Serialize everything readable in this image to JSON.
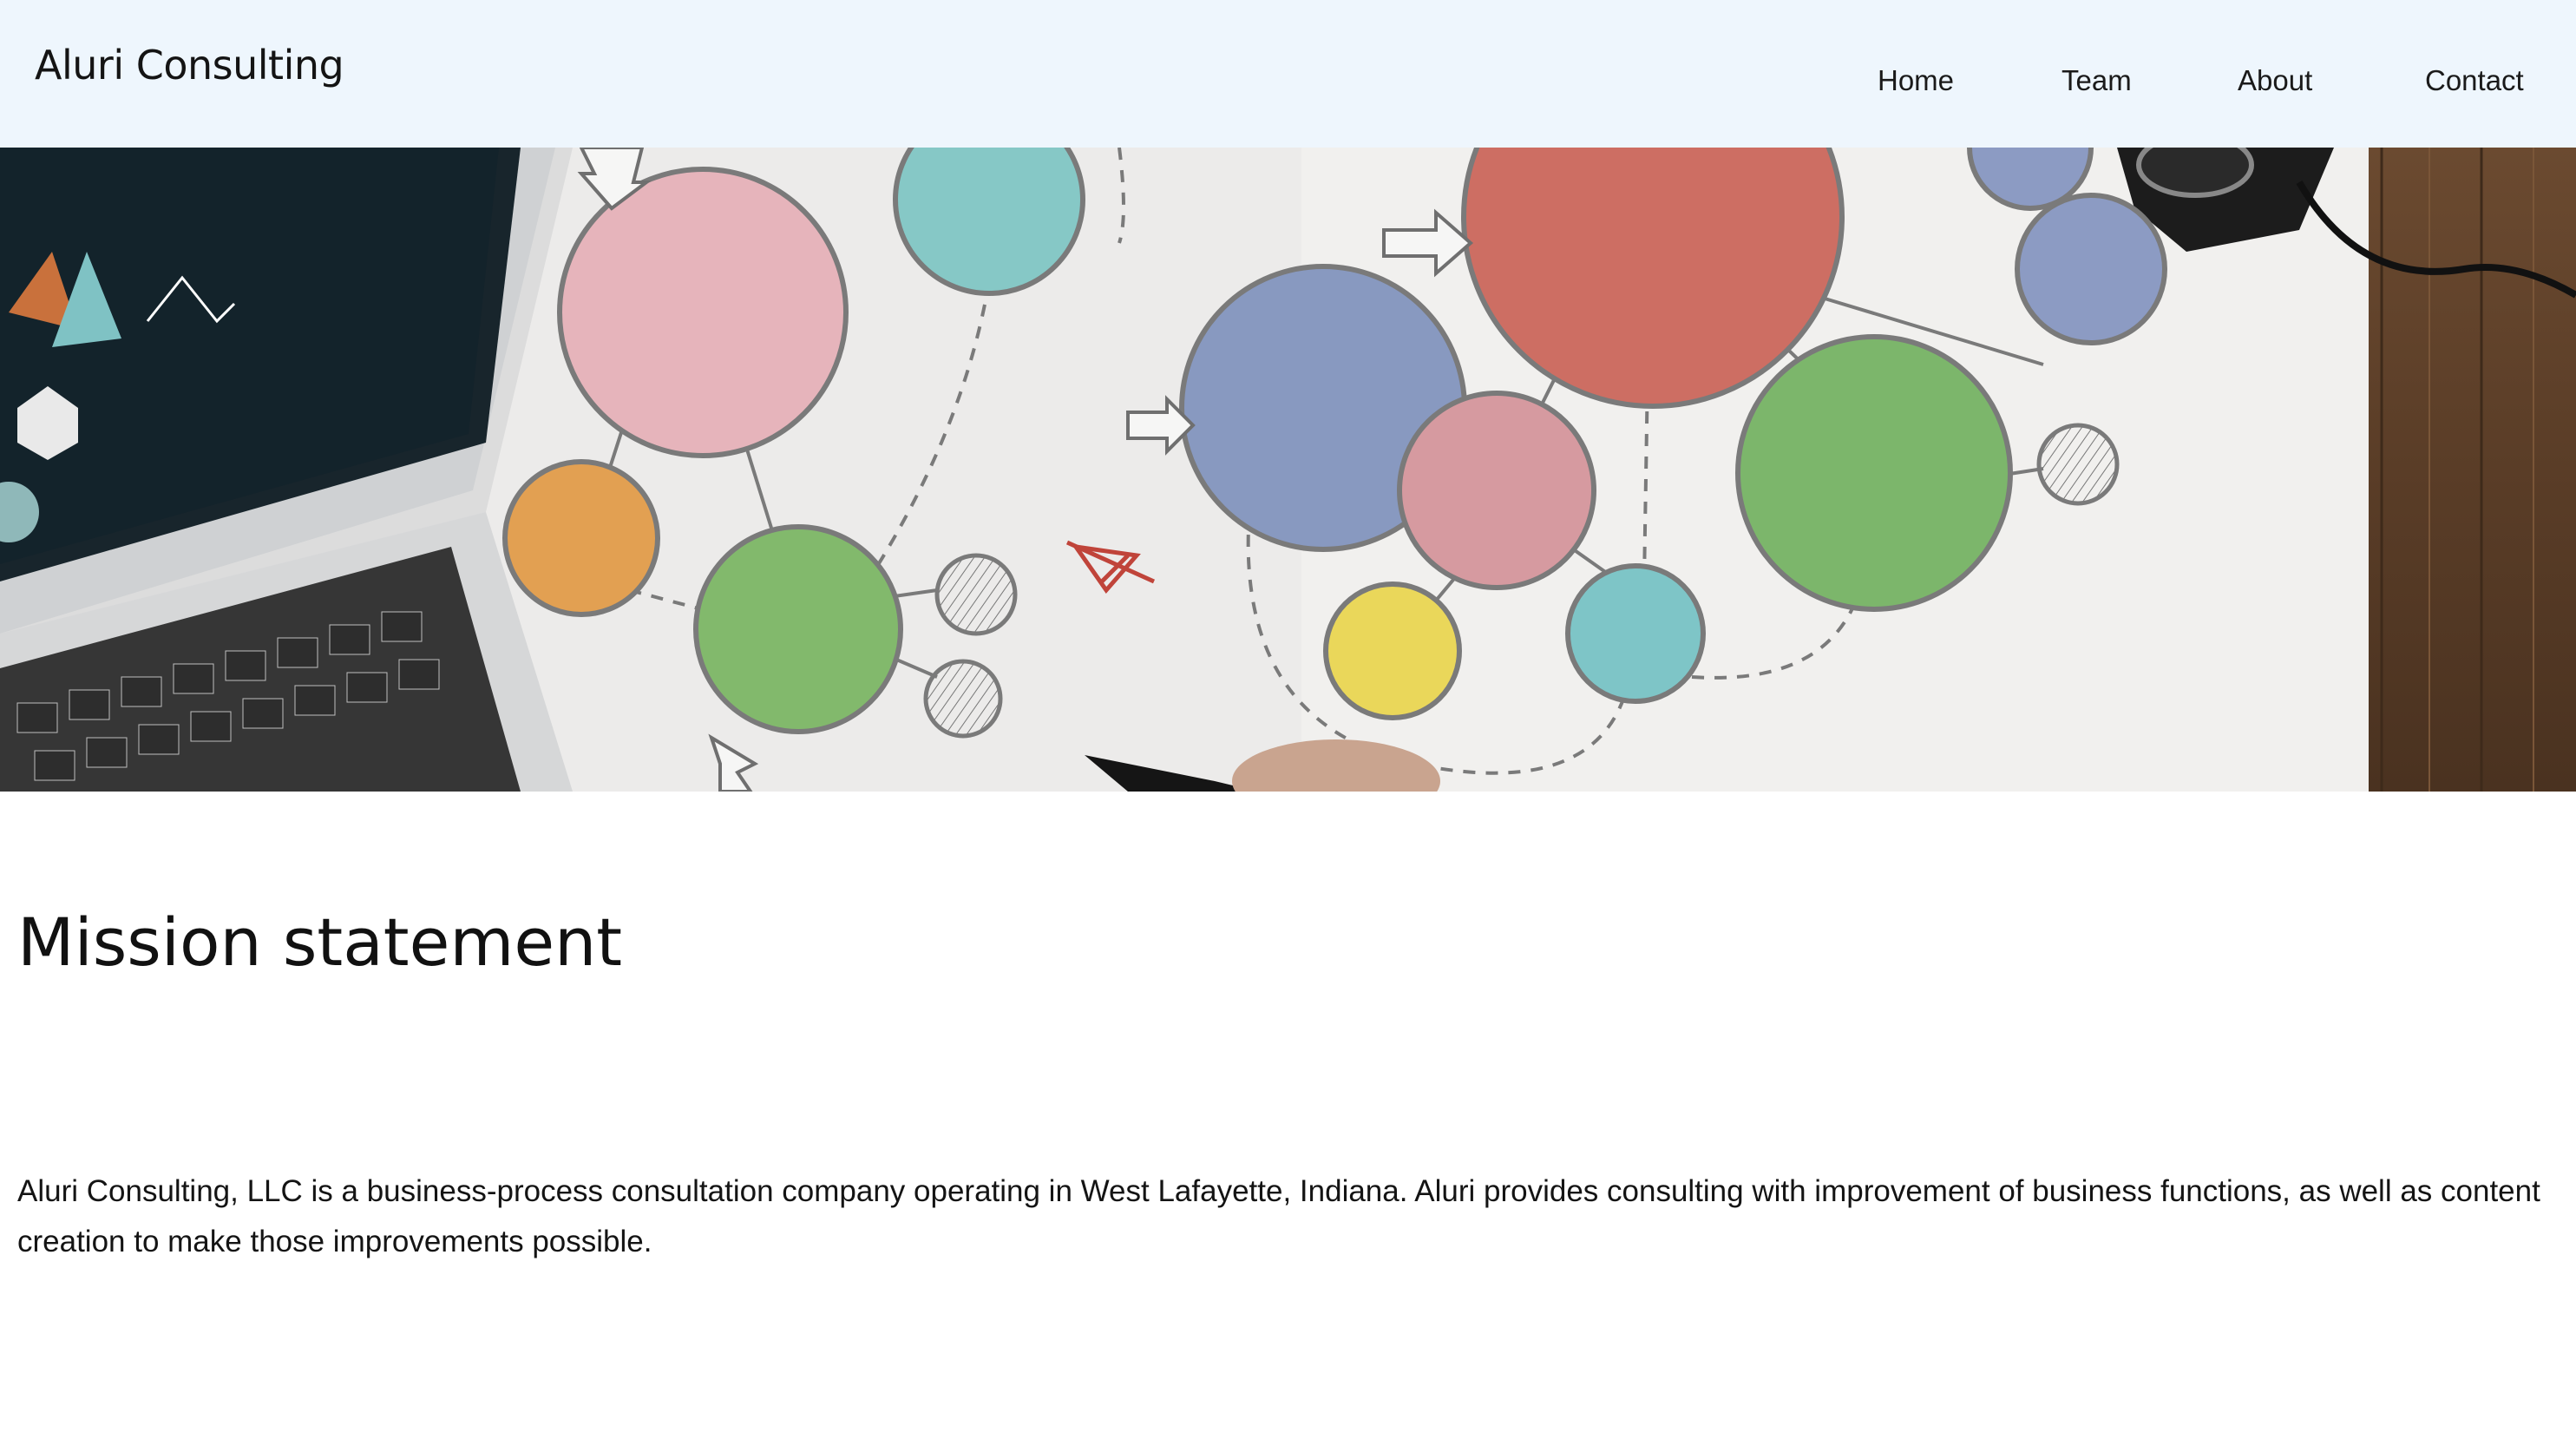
{
  "header": {
    "brand": "Aluri Consulting",
    "nav": [
      "Home",
      "Team",
      "About",
      "Contact"
    ]
  },
  "hero": {
    "description": "",
    "icons": [
      "laptop",
      "circle-diagram",
      "camera",
      "pen",
      "wooden-desk"
    ]
  },
  "main": {
    "heading": "Mission statement",
    "body": "Aluri Consulting, LLC is a business-process consultation company operating in West Lafayette, Indiana. Aluri provides consulting with improvement of business functions, as well as content creation to make those improvements possible."
  },
  "colors": {
    "header_bg": "#eef6fd",
    "page_bg": "#ffffff",
    "text": "#111111"
  }
}
